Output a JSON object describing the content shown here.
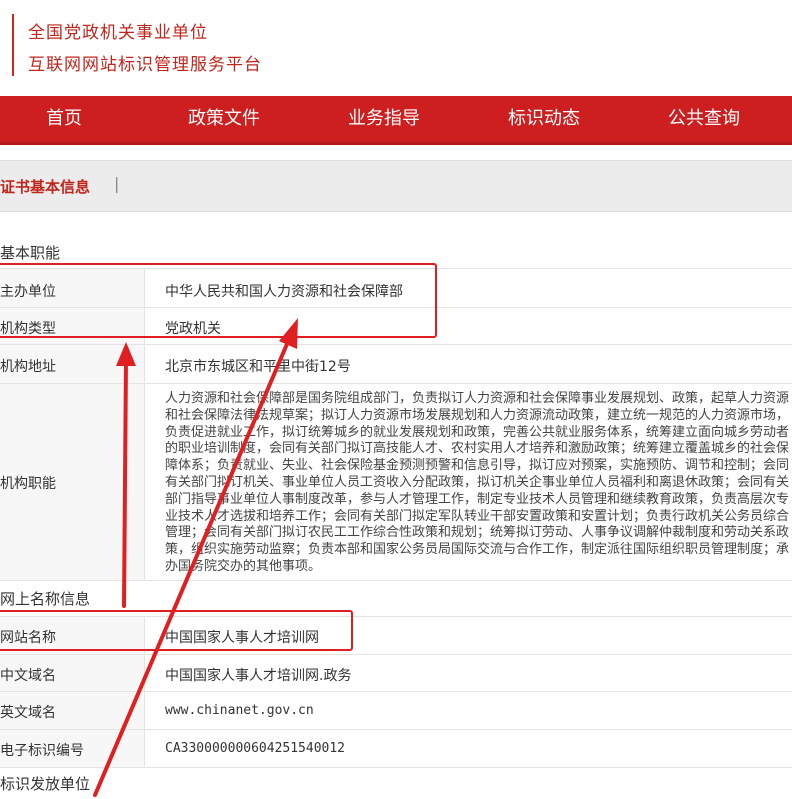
{
  "header": {
    "line1": "全国党政机关事业单位",
    "line2": "互联网网站标识管理服务平台"
  },
  "nav": {
    "items": [
      "首页",
      "政策文件",
      "业务指导",
      "标识动态",
      "公共查询"
    ]
  },
  "cert_bar": {
    "title": "证书基本信息",
    "separator": "|"
  },
  "sections": {
    "basic": "基本职能",
    "online": "网上名称信息",
    "issuer": "标识发放单位"
  },
  "basic_rows": {
    "host_unit": {
      "label": "主办单位",
      "value": "中华人民共和国人力资源和社会保障部"
    },
    "org_type": {
      "label": "机构类型",
      "value": "党政机关"
    },
    "org_address": {
      "label": "机构地址",
      "value": "北京市东城区和平里中街12号"
    },
    "org_duties": {
      "label": "机构职能",
      "lines": [
        "人力资源和社会保障部是国务院组成部门，负责拟订人力资源和社会保障事业发展规划、政策，起草人力资源",
        "和社会保障法律法规草案；拟订人力资源市场发展规划和人力资源流动政策，建立统一规范的人力资源市场，",
        "负责促进就业工作，拟订统筹城乡的就业发展规划和政策，完善公共就业服务体系，统筹建立面向城乡劳动者",
        "的职业培训制度，会同有关部门拟订高技能人才、农村实用人才培养和激励政策；统筹建立覆盖城乡的社会保",
        "障体系；负责就业、失业、社会保险基金预测预警和信息引导，拟订应对预案，实施预防、调节和控制；会同",
        "有关部门拟订机关、事业单位人员工资收入分配政策，拟订机关企事业单位人员福利和离退休政策；会同有关",
        "部门指导事业单位人事制度改革，参与人才管理工作，制定专业技术人员管理和继续教育政策，负责高层次专",
        "业技术人才选拔和培养工作；会同有关部门拟定军队转业干部安置政策和安置计划；负责行政机关公务员综合",
        "管理；会同有关部门拟订农民工工作综合性政策和规划；统筹拟订劳动、人事争议调解仲裁制度和劳动关系政",
        "策，组织实施劳动监察；负责本部和国家公务员局国际交流与合作工作，制定派往国际组织职员管理制度；承",
        "办国务院交办的其他事项。"
      ]
    }
  },
  "online_rows": {
    "site_name": {
      "label": "网站名称",
      "value": "中国国家人事人才培训网"
    },
    "cn_domain": {
      "label": "中文域名",
      "value": "中国国家人事人才培训网.政务"
    },
    "en_domain": {
      "label": "英文域名",
      "value": "www.chinanet.gov.cn"
    },
    "id_number": {
      "label": "电子标识编号",
      "value": "CA330000000604251540012"
    }
  },
  "colors": {
    "brand_red": "#cd1f1f",
    "annotation_red": "#e02020",
    "label_bg": "#f7f7f7"
  }
}
